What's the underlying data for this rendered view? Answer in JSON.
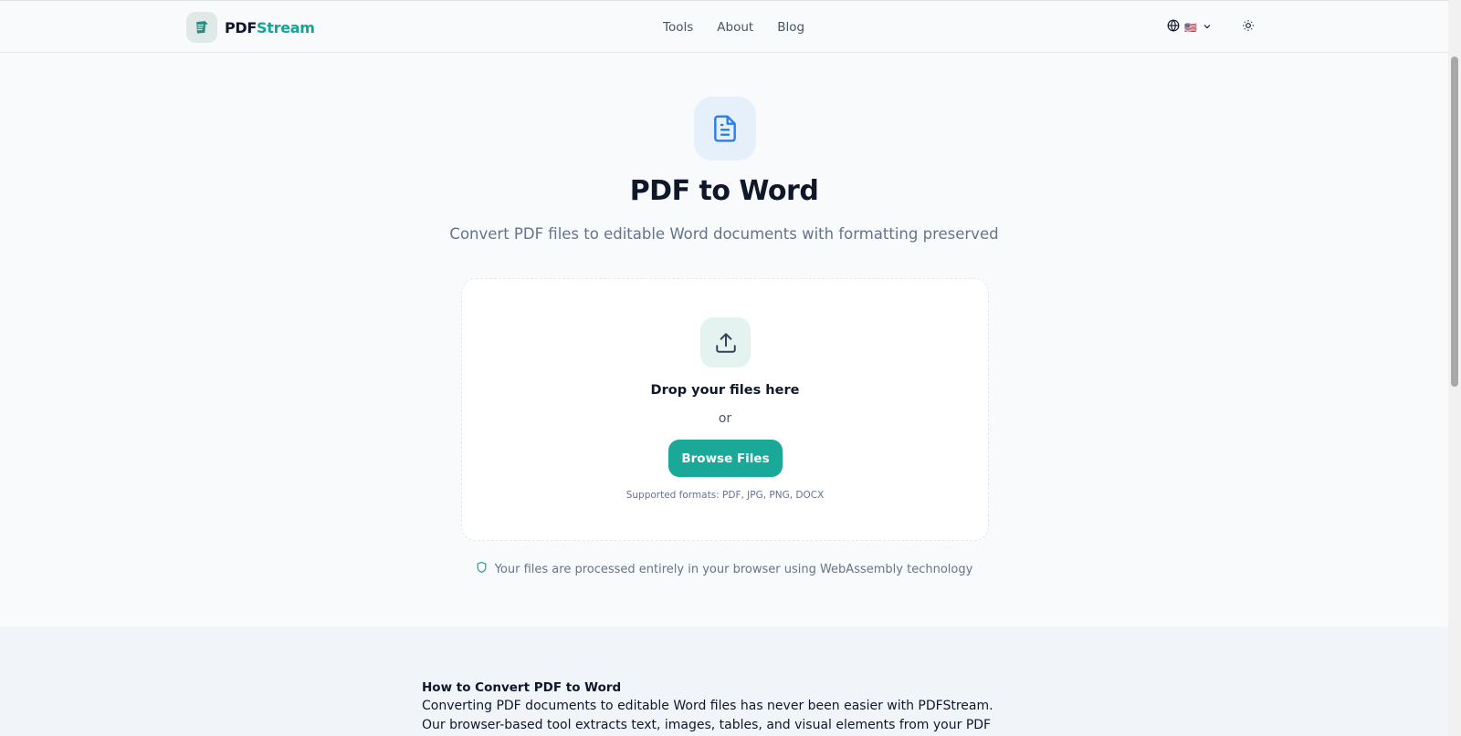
{
  "header": {
    "logo": {
      "part1": "PDF",
      "part2": "Stream"
    },
    "nav": [
      "Tools",
      "About",
      "Blog"
    ],
    "language": {
      "flag": "🇺🇸"
    }
  },
  "hero": {
    "title": "PDF to Word",
    "subtitle": "Convert PDF files to editable Word documents with formatting preserved"
  },
  "dropzone": {
    "title": "Drop your files here",
    "or": "or",
    "button": "Browse Files",
    "formats": "Supported formats: PDF, JPG, PNG, DOCX"
  },
  "privacy_note": "Your files are processed entirely in your browser using WebAssembly technology",
  "info": {
    "heading": "How to Convert PDF to Word",
    "text": "Converting PDF documents to editable Word files has never been easier with PDFStream. Our browser-based tool extracts text, images, tables, and visual elements from your PDF and creates a"
  },
  "colors": {
    "accent": "#1aa899",
    "brand_stream": "#14a493",
    "doc_icon": "#2b7de9"
  },
  "icons": [
    "logo-icon",
    "globe-icon",
    "chevron-down-icon",
    "sun-icon",
    "document-icon",
    "upload-icon",
    "shield-icon"
  ]
}
